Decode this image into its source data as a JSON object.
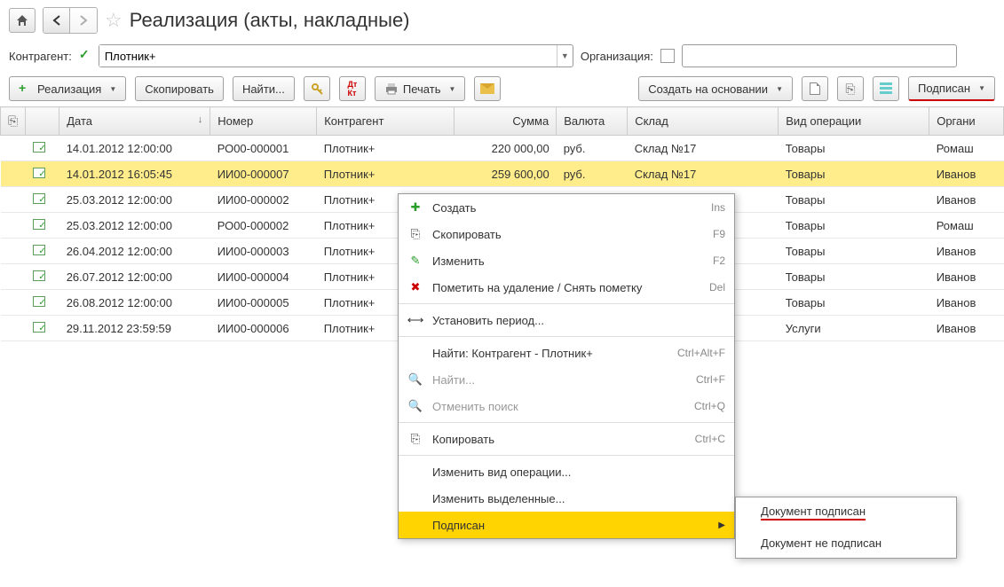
{
  "header": {
    "title": "Реализация (акты, накладные)"
  },
  "filters": {
    "counterparty_label": "Контрагент:",
    "counterparty_value": "Плотник+",
    "org_label": "Организация:"
  },
  "toolbar": {
    "realization": "Реализация",
    "copy": "Скопировать",
    "find": "Найти...",
    "print": "Печать",
    "create_based": "Создать на основании",
    "signed": "Подписан"
  },
  "columns": {
    "date": "Дата",
    "number": "Номер",
    "counterparty": "Контрагент",
    "sum": "Сумма",
    "currency": "Валюта",
    "warehouse": "Склад",
    "optype": "Вид операции",
    "org": "Органи"
  },
  "rows": [
    {
      "date": "14.01.2012 12:00:00",
      "num": "РО00-000001",
      "cp": "Плотник+",
      "sum": "220 000,00",
      "cur": "руб.",
      "wh": "Склад №17",
      "op": "Товары",
      "org": "Ромаш"
    },
    {
      "date": "14.01.2012 16:05:45",
      "num": "ИИ00-000007",
      "cp": "Плотник+",
      "sum": "259 600,00",
      "cur": "руб.",
      "wh": "Склад №17",
      "op": "Товары",
      "org": "Иванов"
    },
    {
      "date": "25.03.2012 12:00:00",
      "num": "ИИ00-000002",
      "cp": "Плотник+",
      "sum": "",
      "cur": "",
      "wh": "",
      "op": "Товары",
      "org": "Иванов"
    },
    {
      "date": "25.03.2012 12:00:00",
      "num": "РО00-000002",
      "cp": "Плотник+",
      "sum": "",
      "cur": "",
      "wh": "",
      "op": "Товары",
      "org": "Ромаш"
    },
    {
      "date": "26.04.2012 12:00:00",
      "num": "ИИ00-000003",
      "cp": "Плотник+",
      "sum": "",
      "cur": "",
      "wh": "",
      "op": "Товары",
      "org": "Иванов"
    },
    {
      "date": "26.07.2012 12:00:00",
      "num": "ИИ00-000004",
      "cp": "Плотник+",
      "sum": "",
      "cur": "",
      "wh": "",
      "op": "Товары",
      "org": "Иванов"
    },
    {
      "date": "26.08.2012 12:00:00",
      "num": "ИИ00-000005",
      "cp": "Плотник+",
      "sum": "",
      "cur": "",
      "wh": "",
      "op": "Товары",
      "org": "Иванов"
    },
    {
      "date": "29.11.2012 23:59:59",
      "num": "ИИ00-000006",
      "cp": "Плотник+",
      "sum": "",
      "cur": "",
      "wh": "",
      "op": "Услуги",
      "org": "Иванов"
    }
  ],
  "ctx": {
    "create": "Создать",
    "create_key": "Ins",
    "copy": "Скопировать",
    "copy_key": "F9",
    "edit": "Изменить",
    "edit_key": "F2",
    "mark": "Пометить на удаление / Снять пометку",
    "mark_key": "Del",
    "period": "Установить период...",
    "find_cp": "Найти: Контрагент - Плотник+",
    "find_cp_key": "Ctrl+Alt+F",
    "find": "Найти...",
    "find_key": "Ctrl+F",
    "cancel_find": "Отменить поиск",
    "cancel_find_key": "Ctrl+Q",
    "copyc": "Копировать",
    "copyc_key": "Ctrl+C",
    "change_op": "Изменить вид операции...",
    "change_sel": "Изменить выделенные...",
    "signed": "Подписан"
  },
  "submenu": {
    "doc_signed": "Документ подписан",
    "doc_not_signed": "Документ не подписан"
  }
}
